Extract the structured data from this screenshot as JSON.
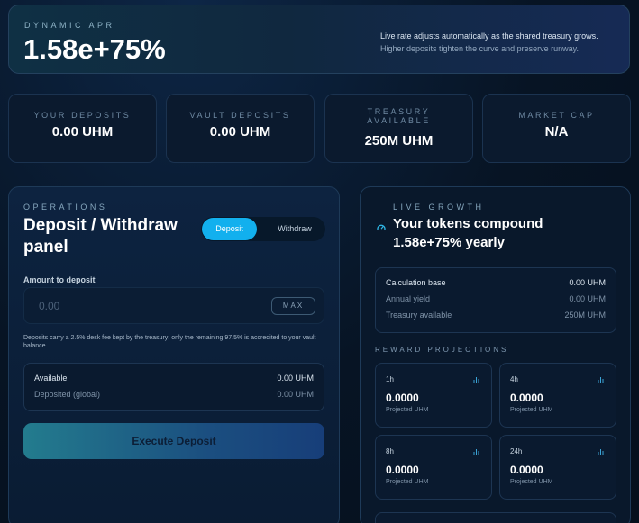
{
  "hero": {
    "kicker": "DYNAMIC APR",
    "apr": "1.58e+75%",
    "note_line1": "Live rate adjusts automatically as the shared treasury grows.",
    "note_line2": "Higher deposits tighten the curve and preserve runway."
  },
  "stats": [
    {
      "label": "YOUR DEPOSITS",
      "value": "0.00 UHM"
    },
    {
      "label": "VAULT DEPOSITS",
      "value": "0.00 UHM"
    },
    {
      "label_line1": "TREASURY",
      "label_line2": "AVAILABLE",
      "value": "250M UHM"
    },
    {
      "label": "MARKET CAP",
      "value": "N/A"
    }
  ],
  "operations": {
    "kicker": "OPERATIONS",
    "title_line1": "Deposit / Withdraw",
    "title_line2": "panel",
    "tab_deposit": "Deposit",
    "tab_withdraw": "Withdraw",
    "amount_label": "Amount to deposit",
    "amount_placeholder": "0.00",
    "max_label": "MAX",
    "fee_note": "Deposits carry a 2.5% desk fee kept by the treasury; only the remaining 97.5% is accredited to your vault balance.",
    "available_label": "Available",
    "available_value": "0.00 UHM",
    "deposited_label": "Deposited (global)",
    "deposited_value": "0.00 UHM",
    "execute_label": "Execute Deposit"
  },
  "live": {
    "kicker": "LIVE GROWTH",
    "headline_line1": "Your tokens compound",
    "headline_line2": "1.58e+75% yearly",
    "calc_label": "Calculation base",
    "calc_value": "0.00 UHM",
    "annual_label": "Annual yield",
    "annual_value": "0.00 UHM",
    "treasury_label": "Treasury available",
    "treasury_value": "250M UHM",
    "projections_title": "REWARD PROJECTIONS",
    "projections": [
      {
        "period": "1h",
        "value": "0.0000",
        "unit": "Projected UHM"
      },
      {
        "period": "4h",
        "value": "0.0000",
        "unit": "Projected UHM"
      },
      {
        "period": "8h",
        "value": "0.0000",
        "unit": "Projected UHM"
      },
      {
        "period": "24h",
        "value": "0.0000",
        "unit": "Projected UHM"
      }
    ]
  },
  "colors": {
    "accent": "#12b0ee",
    "background": "#071424",
    "card": "#0b1a2e"
  }
}
